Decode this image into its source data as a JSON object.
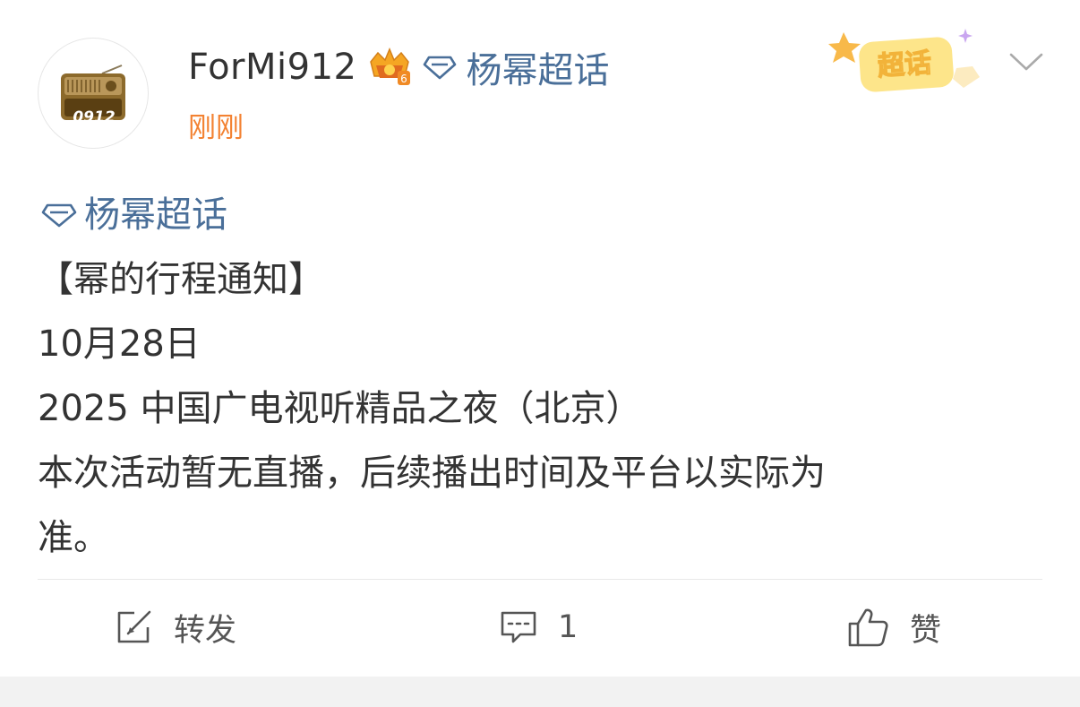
{
  "post": {
    "author": {
      "name": "ForMi912",
      "avatar_text": "0912",
      "badge_icon": "crown-level-badge-icon",
      "badge_level": "6"
    },
    "header_topic": "杨幂超话",
    "time": "刚刚",
    "chaohua_badge": "超话",
    "body": {
      "topic": "杨幂超话",
      "lines": [
        "【幂的行程通知】",
        "10月28日",
        "2025 中国广电视听精品之夜（北京）",
        "本次活动暂无直播，后续播出时间及平台以实际为",
        "准。"
      ]
    }
  },
  "actions": {
    "repost_label": "转发",
    "comment_count": "1",
    "like_label": "赞"
  },
  "colors": {
    "topic_blue": "#4a6f99",
    "time_orange": "#f38232",
    "text": "#333333",
    "divider": "#e8e8e8",
    "background_gap": "#f2f2f2"
  }
}
